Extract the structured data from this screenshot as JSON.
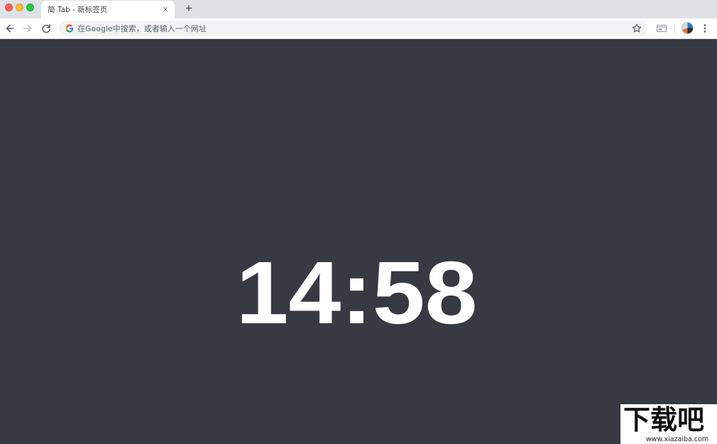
{
  "window": {
    "tab_title": "简 Tab - 新标签页",
    "tab_close_glyph": "×",
    "new_tab_glyph": "+"
  },
  "omnibox": {
    "placeholder": "在Google中搜索，或者输入一个网址"
  },
  "clock": {
    "time": "14:58"
  },
  "watermark": {
    "text": "下载吧",
    "url": "www.xiazaiba.com"
  },
  "colors": {
    "background": "#373a42",
    "clock": "#ffffff",
    "tab_strip": "#dee1e6"
  },
  "icons": [
    "back-arrow-icon",
    "forward-arrow-icon",
    "reload-icon",
    "google-g-icon",
    "star-icon",
    "extension-icon",
    "avatar",
    "more-menu-icon"
  ]
}
